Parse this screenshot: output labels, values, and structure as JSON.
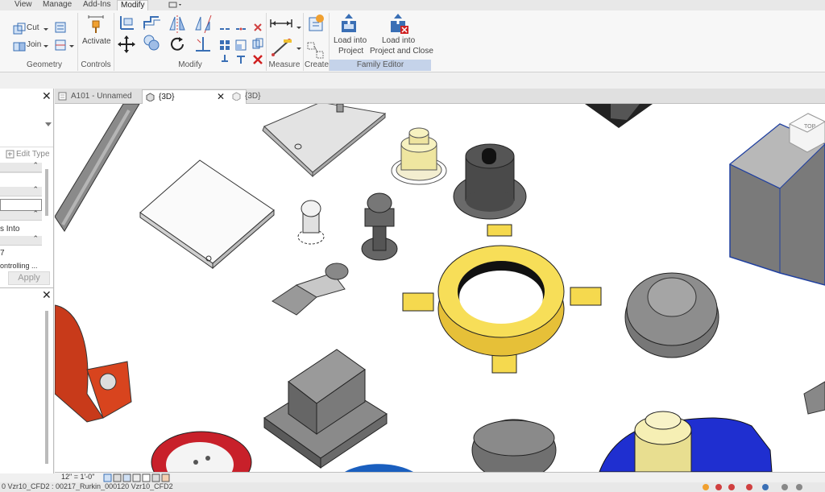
{
  "ribbon": {
    "tabs": [
      "View",
      "Manage",
      "Add-Ins",
      "Modify"
    ],
    "active_tab": "Modify",
    "geometry": {
      "cut_label": "Cut",
      "join_label": "Join",
      "title": "Geometry"
    },
    "controls": {
      "activate_label": "Activate",
      "title": "Controls"
    },
    "modify": {
      "title": "Modify"
    },
    "measure": {
      "title": "Measure"
    },
    "create": {
      "title": "Create"
    },
    "family_editor": {
      "load_project_line1": "Load into",
      "load_project_line2": "Project",
      "load_close_line1": "Load into",
      "load_close_line2": "Project and Close",
      "title": "Family Editor"
    }
  },
  "view_tabs": {
    "tab1": "A101 - Unnamed",
    "tab2": "{3D}",
    "tab3": "{3D}"
  },
  "properties": {
    "edit_type_label": "Edit Type",
    "field_into": "s Into",
    "field_seven": "7",
    "field_controlling": "ontrolling ...",
    "apply_label": "Apply"
  },
  "viewcube": {
    "label": "TOP"
  },
  "view_control": {
    "scale": "12\" = 1'-0\""
  },
  "status": {
    "text": "0 Vzr10_CFD2 : 00217_Rurkin_000120 Vzr10_CFD2"
  }
}
